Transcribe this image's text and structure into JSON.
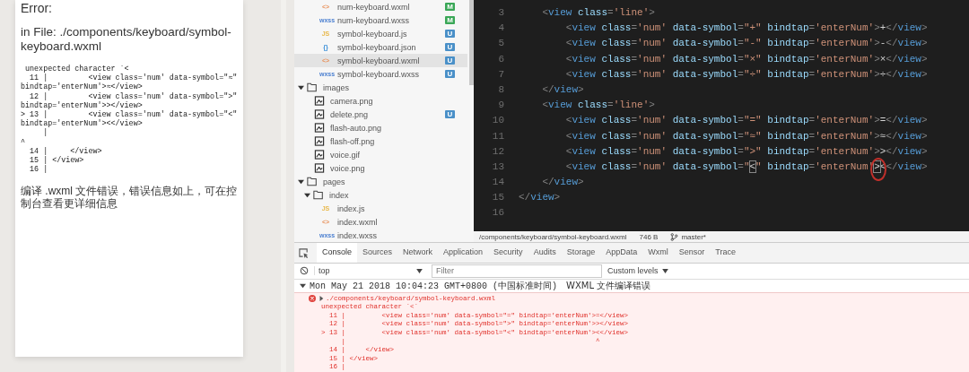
{
  "simulator": {
    "title": "Error:",
    "file_line": "in File: ./components/keyboard/symbol-keyboard.wxml",
    "code_lines": [
      " unexpected character `<",
      "  11 |         <view class='num' data-symbol=\"≈\"",
      "bindtap='enterNum'>≈</view>",
      "  12 |         <view class='num' data-symbol=\">\"",
      "bindtap='enterNum'>></view>",
      "> 13 |         <view class='num' data-symbol=\"<\"",
      "bindtap='enterNum'><</view>",
      "     |",
      "^",
      "  14 |     </view>",
      "  15 | </view>",
      "  16 |"
    ],
    "message": "编译 .wxml 文件错误，错误信息如上，可在控制台查看更详细信息"
  },
  "file_tree": [
    {
      "name": "num-keyboard.wxml",
      "kind": "wxml",
      "icon_text": "<>",
      "badge": "M",
      "color": "#3aa757",
      "selected": false
    },
    {
      "name": "num-keyboard.wxss",
      "kind": "wxss",
      "icon_text": "wxss",
      "badge": "M",
      "color": "#3aa757",
      "selected": false
    },
    {
      "name": "symbol-keyboard.js",
      "kind": "js",
      "icon_text": "JS",
      "badge": "U",
      "color": "#4a90c8",
      "selected": false
    },
    {
      "name": "symbol-keyboard.json",
      "kind": "json",
      "icon_text": "{}",
      "badge": "U",
      "color": "#4a90c8",
      "selected": false
    },
    {
      "name": "symbol-keyboard.wxml",
      "kind": "wxml",
      "icon_text": "<>",
      "badge": "U",
      "color": "#4a90c8",
      "selected": true
    },
    {
      "name": "symbol-keyboard.wxss",
      "kind": "wxss",
      "icon_text": "wxss",
      "badge": "U",
      "color": "#4a90c8",
      "selected": false
    },
    {
      "name": "images",
      "kind": "folder",
      "expanded": true,
      "selected": false,
      "children": [
        {
          "name": "camera.png",
          "kind": "image",
          "selected": false
        },
        {
          "name": "delete.png",
          "kind": "image",
          "badge": "U",
          "color": "#4a90c8",
          "selected": false
        },
        {
          "name": "flash-auto.png",
          "kind": "image",
          "selected": false
        },
        {
          "name": "flash-off.png",
          "kind": "image",
          "selected": false
        },
        {
          "name": "voice.gif",
          "kind": "image",
          "selected": false
        },
        {
          "name": "voice.png",
          "kind": "image",
          "selected": false
        }
      ]
    },
    {
      "name": "pages",
      "kind": "folder",
      "expanded": true,
      "selected": false,
      "children": [
        {
          "name": "index",
          "kind": "folder",
          "expanded": true,
          "selected": false,
          "children": [
            {
              "name": "index.js",
              "kind": "js",
              "icon_text": "JS",
              "selected": false
            },
            {
              "name": "index.wxml",
              "kind": "wxml",
              "icon_text": "<>",
              "selected": false
            },
            {
              "name": "index.wxss",
              "kind": "wxss",
              "icon_text": "wxss",
              "selected": false
            }
          ]
        }
      ]
    }
  ],
  "editor": {
    "lines": [
      {
        "number": "3",
        "tokens": [
          {
            "kind": "punct",
            "text": "    <"
          },
          {
            "kind": "tag",
            "text": "view"
          },
          {
            "kind": "attr",
            "text": " class"
          },
          {
            "kind": "punct",
            "text": "="
          },
          {
            "kind": "string",
            "text": "'line'"
          },
          {
            "kind": "punct",
            "text": ">"
          }
        ]
      },
      {
        "number": "4",
        "tokens": [
          {
            "kind": "punct",
            "text": "        <"
          },
          {
            "kind": "tag",
            "text": "view"
          },
          {
            "kind": "attr",
            "text": " class"
          },
          {
            "kind": "punct",
            "text": "="
          },
          {
            "kind": "string",
            "text": "'num'"
          },
          {
            "kind": "attr",
            "text": " data-symbol"
          },
          {
            "kind": "punct",
            "text": "="
          },
          {
            "kind": "string",
            "text": "\"+\""
          },
          {
            "kind": "attr",
            "text": " bindtap"
          },
          {
            "kind": "punct",
            "text": "="
          },
          {
            "kind": "string",
            "text": "'enterNum'"
          },
          {
            "kind": "punct",
            "text": ">"
          },
          {
            "kind": "text",
            "text": "+"
          },
          {
            "kind": "punct",
            "text": "</"
          },
          {
            "kind": "tag",
            "text": "view"
          },
          {
            "kind": "punct",
            "text": ">"
          }
        ]
      },
      {
        "number": "5",
        "tokens": [
          {
            "kind": "punct",
            "text": "        <"
          },
          {
            "kind": "tag",
            "text": "view"
          },
          {
            "kind": "attr",
            "text": " class"
          },
          {
            "kind": "punct",
            "text": "="
          },
          {
            "kind": "string",
            "text": "'num'"
          },
          {
            "kind": "attr",
            "text": " data-symbol"
          },
          {
            "kind": "punct",
            "text": "="
          },
          {
            "kind": "string",
            "text": "\"-\""
          },
          {
            "kind": "attr",
            "text": " bindtap"
          },
          {
            "kind": "punct",
            "text": "="
          },
          {
            "kind": "string",
            "text": "'enterNum'"
          },
          {
            "kind": "punct",
            "text": ">"
          },
          {
            "kind": "text",
            "text": "-"
          },
          {
            "kind": "punct",
            "text": "</"
          },
          {
            "kind": "tag",
            "text": "view"
          },
          {
            "kind": "punct",
            "text": ">"
          }
        ]
      },
      {
        "number": "6",
        "tokens": [
          {
            "kind": "punct",
            "text": "        <"
          },
          {
            "kind": "tag",
            "text": "view"
          },
          {
            "kind": "attr",
            "text": " class"
          },
          {
            "kind": "punct",
            "text": "="
          },
          {
            "kind": "string",
            "text": "'num'"
          },
          {
            "kind": "attr",
            "text": " data-symbol"
          },
          {
            "kind": "punct",
            "text": "="
          },
          {
            "kind": "string",
            "text": "\"×\""
          },
          {
            "kind": "attr",
            "text": " bindtap"
          },
          {
            "kind": "punct",
            "text": "="
          },
          {
            "kind": "string",
            "text": "'enterNum'"
          },
          {
            "kind": "punct",
            "text": ">"
          },
          {
            "kind": "text",
            "text": "×"
          },
          {
            "kind": "punct",
            "text": "</"
          },
          {
            "kind": "tag",
            "text": "view"
          },
          {
            "kind": "punct",
            "text": ">"
          }
        ]
      },
      {
        "number": "7",
        "tokens": [
          {
            "kind": "punct",
            "text": "        <"
          },
          {
            "kind": "tag",
            "text": "view"
          },
          {
            "kind": "attr",
            "text": " class"
          },
          {
            "kind": "punct",
            "text": "="
          },
          {
            "kind": "string",
            "text": "'num'"
          },
          {
            "kind": "attr",
            "text": " data-symbol"
          },
          {
            "kind": "punct",
            "text": "="
          },
          {
            "kind": "string",
            "text": "\"÷\""
          },
          {
            "kind": "attr",
            "text": " bindtap"
          },
          {
            "kind": "punct",
            "text": "="
          },
          {
            "kind": "string",
            "text": "'enterNum'"
          },
          {
            "kind": "punct",
            "text": ">"
          },
          {
            "kind": "text",
            "text": "÷"
          },
          {
            "kind": "punct",
            "text": "</"
          },
          {
            "kind": "tag",
            "text": "view"
          },
          {
            "kind": "punct",
            "text": ">"
          }
        ]
      },
      {
        "number": "8",
        "tokens": [
          {
            "kind": "punct",
            "text": "    </"
          },
          {
            "kind": "tag",
            "text": "view"
          },
          {
            "kind": "punct",
            "text": ">"
          }
        ]
      },
      {
        "number": "9",
        "tokens": [
          {
            "kind": "punct",
            "text": "    <"
          },
          {
            "kind": "tag",
            "text": "view"
          },
          {
            "kind": "attr",
            "text": " class"
          },
          {
            "kind": "punct",
            "text": "="
          },
          {
            "kind": "string",
            "text": "'line'"
          },
          {
            "kind": "punct",
            "text": ">"
          }
        ]
      },
      {
        "number": "10",
        "tokens": [
          {
            "kind": "punct",
            "text": "        <"
          },
          {
            "kind": "tag",
            "text": "view"
          },
          {
            "kind": "attr",
            "text": " class"
          },
          {
            "kind": "punct",
            "text": "="
          },
          {
            "kind": "string",
            "text": "'num'"
          },
          {
            "kind": "attr",
            "text": " data-symbol"
          },
          {
            "kind": "punct",
            "text": "="
          },
          {
            "kind": "string",
            "text": "\"=\""
          },
          {
            "kind": "attr",
            "text": " bindtap"
          },
          {
            "kind": "punct",
            "text": "="
          },
          {
            "kind": "string",
            "text": "'enterNum'"
          },
          {
            "kind": "punct",
            "text": ">"
          },
          {
            "kind": "text",
            "text": "="
          },
          {
            "kind": "punct",
            "text": "</"
          },
          {
            "kind": "tag",
            "text": "view"
          },
          {
            "kind": "punct",
            "text": ">"
          }
        ]
      },
      {
        "number": "11",
        "tokens": [
          {
            "kind": "punct",
            "text": "        <"
          },
          {
            "kind": "tag",
            "text": "view"
          },
          {
            "kind": "attr",
            "text": " class"
          },
          {
            "kind": "punct",
            "text": "="
          },
          {
            "kind": "string",
            "text": "'num'"
          },
          {
            "kind": "attr",
            "text": " data-symbol"
          },
          {
            "kind": "punct",
            "text": "="
          },
          {
            "kind": "string",
            "text": "\"≈\""
          },
          {
            "kind": "attr",
            "text": " bindtap"
          },
          {
            "kind": "punct",
            "text": "="
          },
          {
            "kind": "string",
            "text": "'enterNum'"
          },
          {
            "kind": "punct",
            "text": ">"
          },
          {
            "kind": "text",
            "text": "≈"
          },
          {
            "kind": "punct",
            "text": "</"
          },
          {
            "kind": "tag",
            "text": "view"
          },
          {
            "kind": "punct",
            "text": ">"
          }
        ]
      },
      {
        "number": "12",
        "tokens": [
          {
            "kind": "punct",
            "text": "        <"
          },
          {
            "kind": "tag",
            "text": "view"
          },
          {
            "kind": "attr",
            "text": " class"
          },
          {
            "kind": "punct",
            "text": "="
          },
          {
            "kind": "string",
            "text": "'num'"
          },
          {
            "kind": "attr",
            "text": " data-symbol"
          },
          {
            "kind": "punct",
            "text": "="
          },
          {
            "kind": "string",
            "text": "\">\""
          },
          {
            "kind": "attr",
            "text": " bindtap"
          },
          {
            "kind": "punct",
            "text": "="
          },
          {
            "kind": "string",
            "text": "'enterNum'"
          },
          {
            "kind": "punct",
            "text": ">"
          },
          {
            "kind": "text",
            "text": ">"
          },
          {
            "kind": "punct",
            "text": "</"
          },
          {
            "kind": "tag",
            "text": "view"
          },
          {
            "kind": "punct",
            "text": ">"
          }
        ]
      },
      {
        "number": "13",
        "tokens": [
          {
            "kind": "punct",
            "text": "        <"
          },
          {
            "kind": "tag",
            "text": "view"
          },
          {
            "kind": "attr",
            "text": " class"
          },
          {
            "kind": "punct",
            "text": "="
          },
          {
            "kind": "string",
            "text": "'num'"
          },
          {
            "kind": "attr",
            "text": " data-symbol"
          },
          {
            "kind": "punct",
            "text": "="
          },
          {
            "kind": "string",
            "text": "\""
          },
          {
            "kind": "match",
            "text": "<"
          },
          {
            "kind": "string",
            "text": "\""
          },
          {
            "kind": "attr",
            "text": " bindtap"
          },
          {
            "kind": "punct",
            "text": "="
          },
          {
            "kind": "string",
            "text": "'enterNum'"
          },
          {
            "kind": "match",
            "text": ">",
            "circled": true
          },
          {
            "kind": "text",
            "text": "<"
          },
          {
            "kind": "punct",
            "text": "</"
          },
          {
            "kind": "tag",
            "text": "view"
          },
          {
            "kind": "punct",
            "text": ">"
          }
        ]
      },
      {
        "number": "14",
        "tokens": [
          {
            "kind": "punct",
            "text": "    </"
          },
          {
            "kind": "tag",
            "text": "view"
          },
          {
            "kind": "punct",
            "text": ">"
          }
        ]
      },
      {
        "number": "15",
        "tokens": [
          {
            "kind": "punct",
            "text": "</"
          },
          {
            "kind": "tag",
            "text": "view"
          },
          {
            "kind": "punct",
            "text": ">"
          }
        ]
      },
      {
        "number": "16"
      }
    ],
    "status_bar": {
      "path": "/components/keyboard/symbol-keyboard.wxml",
      "size": "746 B",
      "branch": "master*"
    }
  },
  "devtools": {
    "tabs": [
      {
        "label": "Console",
        "selected": true
      },
      {
        "label": "Sources",
        "selected": false
      },
      {
        "label": "Network",
        "selected": false
      },
      {
        "label": "Application",
        "selected": false
      },
      {
        "label": "Security",
        "selected": false
      },
      {
        "label": "Audits",
        "selected": false
      },
      {
        "label": "Storage",
        "selected": false
      },
      {
        "label": "AppData",
        "selected": false
      },
      {
        "label": "Wxml",
        "selected": false
      },
      {
        "label": "Sensor",
        "selected": false
      },
      {
        "label": "Trace",
        "selected": false
      }
    ],
    "context": "top",
    "filter": {
      "placeholder": "Filter"
    },
    "levels": "Custom levels",
    "group": {
      "timestamp": "Mon May 21 2018 10:04:23 GMT+0800 (中国标准时间)",
      "title": "WXML 文件编译错误",
      "expanded": true
    },
    "error": {
      "path": "./components/keyboard/symbol-keyboard.wxml",
      "lines": [
        "unexpected character `<`",
        "  11 |         <view class='num' data-symbol=\"=\" bindtap='enterNum'>=</view>",
        "  12 |         <view class='num' data-symbol=\">\" bindtap='enterNum'>></view>",
        "> 13 |         <view class='num' data-symbol=\"<\" bindtap='enterNum'><</view>",
        "     |                                                              ^",
        "  14 |     </view>",
        "  15 | </view>",
        "  16 |"
      ]
    }
  }
}
